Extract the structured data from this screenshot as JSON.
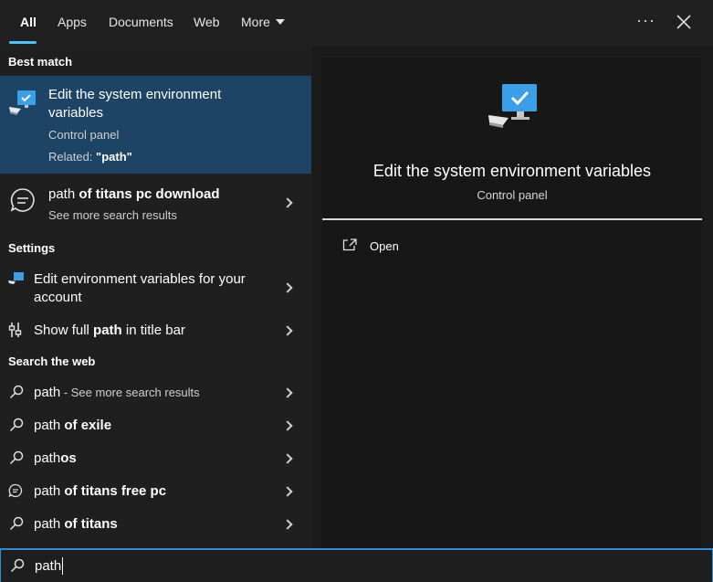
{
  "tabs": [
    {
      "label": "All",
      "active": true
    },
    {
      "label": "Apps"
    },
    {
      "label": "Documents"
    },
    {
      "label": "Web"
    },
    {
      "label": "More"
    }
  ],
  "toolbar": {
    "overflow_label": "···"
  },
  "sections": {
    "best_match": "Best match",
    "settings": "Settings",
    "search_web": "Search the web"
  },
  "best_match": {
    "title_line1": "Edit the system environment",
    "title_line2": "variables",
    "subtitle": "Control panel",
    "related_prefix": "Related: ",
    "related_term": "\"path\"",
    "icon": "computer-with-checkmark-icon"
  },
  "more_results": {
    "query_plain": "path",
    "query_bold": " of titans pc download",
    "subtitle": "See more search results",
    "icon": "speech-bubble-icon"
  },
  "settings": [
    {
      "line1": "Edit environment variables for your",
      "line2": "account",
      "icon": "computer-settings-icon"
    },
    {
      "prefix": "Show full ",
      "bold": "path",
      "suffix": " in title bar",
      "icon": "folder-options-icon"
    }
  ],
  "web_results": [
    {
      "plain": "path",
      "bold": "",
      "extra": " - See more search results",
      "icon": "search-icon"
    },
    {
      "plain": "path",
      "bold": " of exile",
      "extra": "",
      "icon": "search-icon"
    },
    {
      "plain": "path",
      "bold": "os",
      "extra": "",
      "icon": "search-icon"
    },
    {
      "plain": "path",
      "bold": " of titans free pc",
      "extra": "",
      "icon": "chat-bubble-icon"
    },
    {
      "plain": "path",
      "bold": " of titans",
      "extra": "",
      "icon": "search-icon"
    }
  ],
  "preview": {
    "title": "Edit the system environment variables",
    "subtitle": "Control panel",
    "open_label": "Open"
  },
  "search": {
    "value": "path"
  },
  "colors": {
    "accent": "#4cc2ff",
    "selection": "#1d4464",
    "search_border": "#2f8fd6"
  }
}
